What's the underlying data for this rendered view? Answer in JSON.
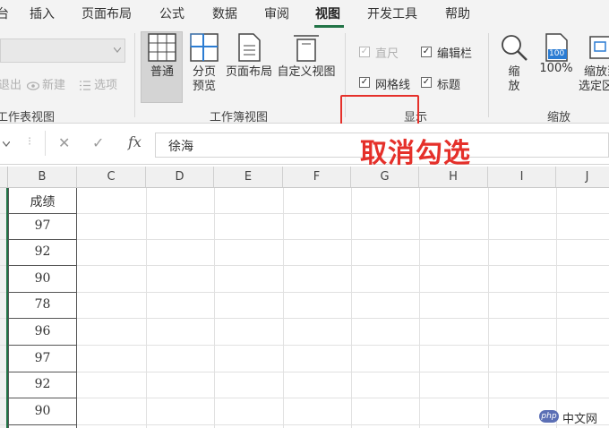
{
  "ribbon_tabs": [
    "台",
    "插入",
    "页面布局",
    "公式",
    "数据",
    "审阅",
    "视图",
    "开发工具",
    "帮助"
  ],
  "active_tab": "视图",
  "workbook_views_group": {
    "label": "工作簿视图",
    "buttons": [
      "普通",
      "分页预览",
      "页面布局",
      "自定义视图"
    ],
    "page_break_line1": "分页",
    "page_break_line2": "预览"
  },
  "sheet_view_group": {
    "label": "工作表视图",
    "items": [
      "退出",
      "新建",
      "选项"
    ]
  },
  "show_group": {
    "label": "显示",
    "checkboxes": [
      {
        "label": "直尺",
        "checked": true,
        "enabled": false
      },
      {
        "label": "编辑栏",
        "checked": true,
        "enabled": true
      },
      {
        "label": "网格线",
        "checked": true,
        "enabled": true
      },
      {
        "label": "标题",
        "checked": true,
        "enabled": true
      }
    ]
  },
  "zoom_group": {
    "label": "缩放",
    "zoom_line1": "缩",
    "zoom_line2": "放",
    "hundred_label": "100%",
    "hundred_icon_text": "100",
    "zoom_to_selection_line1": "缩放到",
    "zoom_to_selection_line2": "选定区域"
  },
  "formula_bar": {
    "fx_label": "fx",
    "value": "徐海"
  },
  "annotation": "取消勾选",
  "columns": [
    "B",
    "C",
    "D",
    "E",
    "F",
    "G",
    "H",
    "I",
    "J"
  ],
  "column_b": {
    "header_text": "成绩",
    "values": [
      "97",
      "92",
      "90",
      "78",
      "96",
      "97",
      "92",
      "90"
    ]
  },
  "watermark": {
    "logo": "php",
    "text": "中文网"
  },
  "colors": {
    "accent_green": "#217346",
    "annotation_red": "#e5302a"
  }
}
